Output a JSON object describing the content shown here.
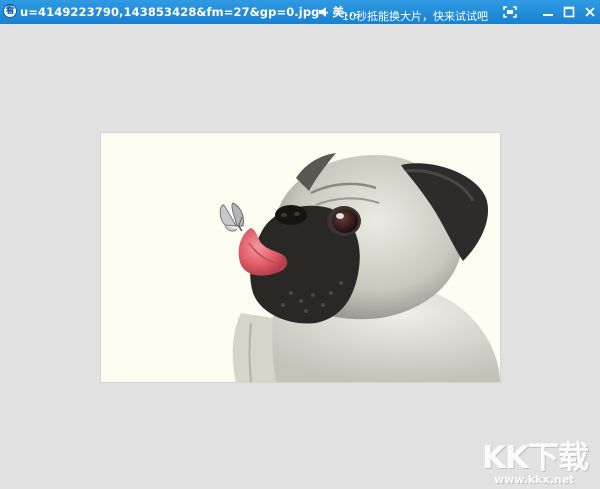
{
  "window": {
    "app_icon_glyph": "看",
    "title": "u=4149223790,143853428&fm=27&gp=0.jpg - 美...",
    "marquee": {
      "line_faded": "",
      "line_main": "10秒抵能换大片，快来试试吧！"
    },
    "controls": {
      "sound_icon": "speaker-icon",
      "fullscreen_icon": "fullscreen-icon",
      "minimize_icon": "minimize-icon",
      "maximize_icon": "maximize-icon",
      "close_icon": "close-icon"
    },
    "colors": {
      "titlebar": "#1f8ad8",
      "viewer_background": "#e1e1e1",
      "photo_background": "#fdfdf2"
    }
  },
  "viewer": {
    "image_name": "pug-with-butterfly-photo"
  },
  "watermark": {
    "logo": "KK下载",
    "url": "www.kkx.net"
  }
}
